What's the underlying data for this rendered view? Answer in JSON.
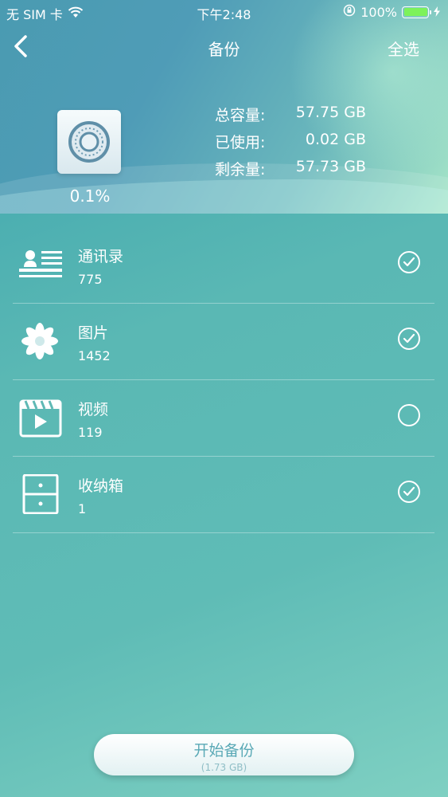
{
  "status_bar": {
    "carrier": "无 SIM 卡",
    "time": "下午2:48",
    "battery_percent": "100%",
    "icons": [
      "wifi-icon",
      "rotation-lock-icon",
      "battery-icon",
      "charging-icon"
    ],
    "battery_color": "#7df25a"
  },
  "nav": {
    "title": "备份",
    "select_all": "全选",
    "back_icon": "chevron-left-icon"
  },
  "storage": {
    "percent": "0.1%",
    "icon": "safe-icon",
    "rows": [
      {
        "label": "总容量:",
        "value": "57.75 GB"
      },
      {
        "label": "已使用:",
        "value": "0.02 GB"
      },
      {
        "label": "剩余量:",
        "value": "57.73 GB"
      }
    ]
  },
  "items": [
    {
      "name": "通讯录",
      "count": "775",
      "icon": "contacts-icon",
      "checked": true
    },
    {
      "name": "图片",
      "count": "1452",
      "icon": "flower-icon",
      "checked": true
    },
    {
      "name": "视频",
      "count": "119",
      "icon": "video-icon",
      "checked": false
    },
    {
      "name": "收纳箱",
      "count": "1",
      "icon": "drawer-icon",
      "checked": true
    }
  ],
  "start_button": {
    "label": "开始备份",
    "size": "(1.73 GB)"
  }
}
